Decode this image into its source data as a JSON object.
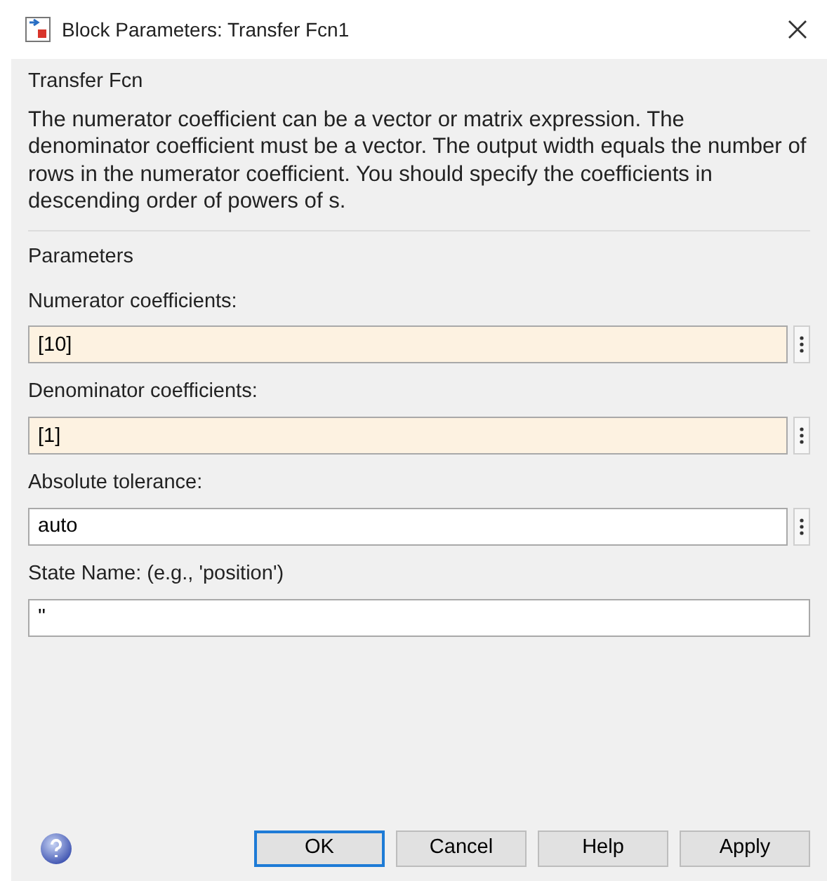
{
  "window": {
    "title": "Block Parameters: Transfer Fcn1"
  },
  "block_type": "Transfer Fcn",
  "description": "The numerator coefficient can be a vector or matrix expression. The denominator coefficient must be a vector. The output width equals the number of rows in the numerator coefficient. You should specify the coefficients in descending order of powers of s.",
  "parameters_heading": "Parameters",
  "fields": [
    {
      "label": "Numerator coefficients:",
      "value": "[10]",
      "highlighted": true,
      "has_menu": true
    },
    {
      "label": "Denominator coefficients:",
      "value": "[1]",
      "highlighted": true,
      "has_menu": true
    },
    {
      "label": "Absolute tolerance:",
      "value": "auto",
      "highlighted": false,
      "has_menu": true
    },
    {
      "label": "State Name: (e.g., 'position')",
      "value": "''",
      "highlighted": false,
      "has_menu": false
    }
  ],
  "buttons": [
    {
      "label": "OK",
      "default": true
    },
    {
      "label": "Cancel",
      "default": false
    },
    {
      "label": "Help",
      "default": false
    },
    {
      "label": "Apply",
      "default": false
    }
  ]
}
